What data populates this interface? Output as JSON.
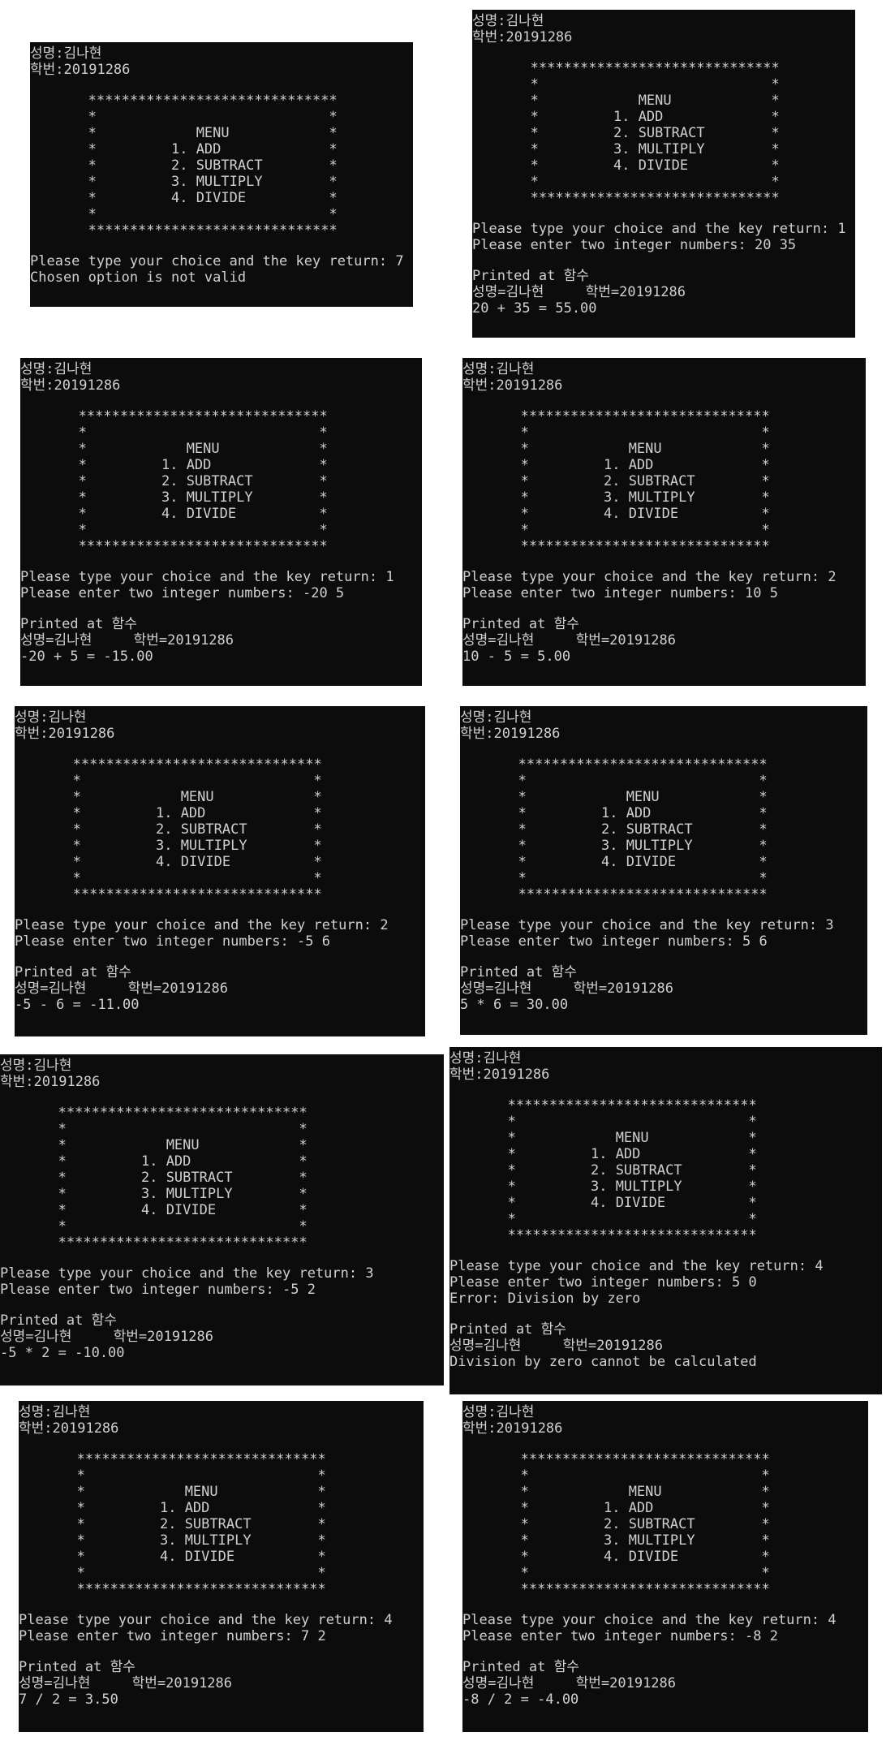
{
  "screenshots": [
    {
      "header": [
        "성명:김나현",
        "학번:20191286"
      ],
      "menu": [
        "       ******************************",
        "       *                            *",
        "       *            MENU            *",
        "       *         1. ADD             *",
        "       *         2. SUBTRACT        *",
        "       *         3. MULTIPLY        *",
        "       *         4. DIVIDE          *",
        "       *                            *",
        "       ******************************"
      ],
      "output": [
        "Please type your choice and the key return: 7",
        "Chosen option is not valid"
      ],
      "result": []
    },
    {
      "header": [
        "성명:김나현",
        "학번:20191286"
      ],
      "menu": [
        "       ******************************",
        "       *                            *",
        "       *            MENU            *",
        "       *         1. ADD             *",
        "       *         2. SUBTRACT        *",
        "       *         3. MULTIPLY        *",
        "       *         4. DIVIDE          *",
        "       *                            *",
        "       ******************************"
      ],
      "output": [
        "Please type your choice and the key return: 1",
        "Please enter two integer numbers: 20 35"
      ],
      "result": [
        "Printed at 함수",
        "성명=김나현     학번=20191286",
        "20 + 35 = 55.00"
      ]
    },
    {
      "header": [
        "성명:김나현",
        "학번:20191286"
      ],
      "menu": [
        "       ******************************",
        "       *                            *",
        "       *            MENU            *",
        "       *         1. ADD             *",
        "       *         2. SUBTRACT        *",
        "       *         3. MULTIPLY        *",
        "       *         4. DIVIDE          *",
        "       *                            *",
        "       ******************************"
      ],
      "output": [
        "Please type your choice and the key return: 1",
        "Please enter two integer numbers: -20 5"
      ],
      "result": [
        "Printed at 함수",
        "성명=김나현     학번=20191286",
        "-20 + 5 = -15.00"
      ]
    },
    {
      "header": [
        "성명:김나현",
        "학번:20191286"
      ],
      "menu": [
        "       ******************************",
        "       *                            *",
        "       *            MENU            *",
        "       *         1. ADD             *",
        "       *         2. SUBTRACT        *",
        "       *         3. MULTIPLY        *",
        "       *         4. DIVIDE          *",
        "       *                            *",
        "       ******************************"
      ],
      "output": [
        "Please type your choice and the key return: 2",
        "Please enter two integer numbers: 10 5"
      ],
      "result": [
        "Printed at 함수",
        "성명=김나현     학번=20191286",
        "10 - 5 = 5.00"
      ]
    },
    {
      "header": [
        "성명:김나현",
        "학번:20191286"
      ],
      "menu": [
        "       ******************************",
        "       *                            *",
        "       *            MENU            *",
        "       *         1. ADD             *",
        "       *         2. SUBTRACT        *",
        "       *         3. MULTIPLY        *",
        "       *         4. DIVIDE          *",
        "       *                            *",
        "       ******************************"
      ],
      "output": [
        "Please type your choice and the key return: 2",
        "Please enter two integer numbers: -5 6"
      ],
      "result": [
        "Printed at 함수",
        "성명=김나현     학번=20191286",
        "-5 - 6 = -11.00"
      ]
    },
    {
      "header": [
        "성명:김나현",
        "학번:20191286"
      ],
      "menu": [
        "       ******************************",
        "       *                            *",
        "       *            MENU            *",
        "       *         1. ADD             *",
        "       *         2. SUBTRACT        *",
        "       *         3. MULTIPLY        *",
        "       *         4. DIVIDE          *",
        "       *                            *",
        "       ******************************"
      ],
      "output": [
        "Please type your choice and the key return: 3",
        "Please enter two integer numbers: 5 6"
      ],
      "result": [
        "Printed at 함수",
        "성명=김나현     학번=20191286",
        "5 * 6 = 30.00"
      ]
    },
    {
      "header": [
        "성명:김나현",
        "학번:20191286"
      ],
      "menu": [
        "       ******************************",
        "       *                            *",
        "       *            MENU            *",
        "       *         1. ADD             *",
        "       *         2. SUBTRACT        *",
        "       *         3. MULTIPLY        *",
        "       *         4. DIVIDE          *",
        "       *                            *",
        "       ******************************"
      ],
      "output": [
        "Please type your choice and the key return: 3",
        "Please enter two integer numbers: -5 2"
      ],
      "result": [
        "Printed at 함수",
        "성명=김나현     학번=20191286",
        "-5 * 2 = -10.00"
      ]
    },
    {
      "header": [
        "성명:김나현",
        "학번:20191286"
      ],
      "menu": [
        "       ******************************",
        "       *                            *",
        "       *            MENU            *",
        "       *         1. ADD             *",
        "       *         2. SUBTRACT        *",
        "       *         3. MULTIPLY        *",
        "       *         4. DIVIDE          *",
        "       *                            *",
        "       ******************************"
      ],
      "output": [
        "Please type your choice and the key return: 4",
        "Please enter two integer numbers: 5 0",
        "Error: Division by zero"
      ],
      "result": [
        "Printed at 함수",
        "성명=김나현     학번=20191286",
        "Division by zero cannot be calculated"
      ]
    },
    {
      "header": [
        "성명:김나현",
        "학번:20191286"
      ],
      "menu": [
        "       ******************************",
        "       *                            *",
        "       *            MENU            *",
        "       *         1. ADD             *",
        "       *         2. SUBTRACT        *",
        "       *         3. MULTIPLY        *",
        "       *         4. DIVIDE          *",
        "       *                            *",
        "       ******************************"
      ],
      "output": [
        "Please type your choice and the key return: 4",
        "Please enter two integer numbers: 7 2"
      ],
      "result": [
        "Printed at 함수",
        "성명=김나현     학번=20191286",
        "7 / 2 = 3.50"
      ]
    },
    {
      "header": [
        "성명:김나현",
        "학번:20191286"
      ],
      "menu": [
        "       ******************************",
        "       *                            *",
        "       *            MENU            *",
        "       *         1. ADD             *",
        "       *         2. SUBTRACT        *",
        "       *         3. MULTIPLY        *",
        "       *         4. DIVIDE          *",
        "       *                            *",
        "       ******************************"
      ],
      "output": [
        "Please type your choice and the key return: 4",
        "Please enter two integer numbers: -8 2"
      ],
      "result": [
        "Printed at 함수",
        "성명=김나현     학번=20191286",
        "-8 / 2 = -4.00"
      ]
    }
  ]
}
